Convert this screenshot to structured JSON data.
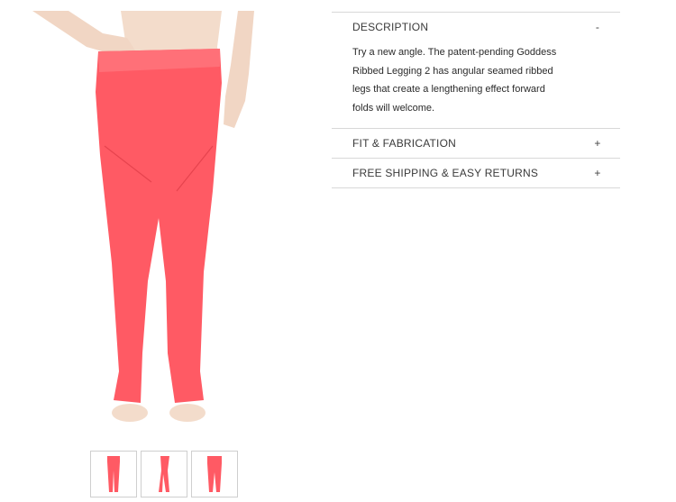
{
  "product": {
    "image_alt": "Goddess Ribbed Legging 2 - coral",
    "thumbnails": [
      "front view",
      "side view",
      "back view"
    ]
  },
  "accordion": {
    "sections": [
      {
        "title": "DESCRIPTION",
        "toggle": "-",
        "expanded": true,
        "body": "Try a new angle. The patent-pending Goddess Ribbed Legging 2 has angular seamed ribbed legs that create a lengthening effect forward folds will welcome."
      },
      {
        "title": "FIT & FABRICATION",
        "toggle": "+",
        "expanded": false
      },
      {
        "title": "FREE SHIPPING & EASY RETURNS",
        "toggle": "+",
        "expanded": false
      }
    ]
  },
  "colors": {
    "legging": "#ff5a64",
    "skin": "#f3dccb",
    "divider": "#d8d8d8"
  }
}
